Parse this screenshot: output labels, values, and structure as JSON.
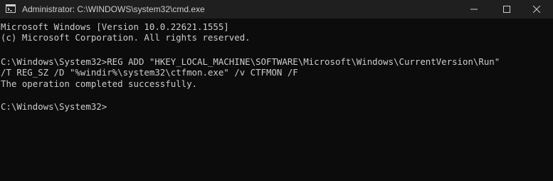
{
  "window": {
    "title": "Administrator: C:\\WINDOWS\\system32\\cmd.exe",
    "icon": "cmd-icon",
    "controls": {
      "minimize_icon": "minimize-icon",
      "maximize_icon": "maximize-icon",
      "close_icon": "close-icon"
    }
  },
  "console": {
    "lines": [
      "Microsoft Windows [Version 10.0.22621.1555]",
      "(c) Microsoft Corporation. All rights reserved.",
      "",
      "C:\\Windows\\System32>REG ADD \"HKEY_LOCAL_MACHINE\\SOFTWARE\\Microsoft\\Windows\\CurrentVersion\\Run\"",
      "/T REG_SZ /D \"%windir%\\system32\\ctfmon.exe\" /v CTFMON /F",
      "The operation completed successfully.",
      "",
      "C:\\Windows\\System32>"
    ]
  },
  "colors": {
    "background": "#0c0c0c",
    "titlebar": "#1f1f1f",
    "text": "#cccccc"
  }
}
